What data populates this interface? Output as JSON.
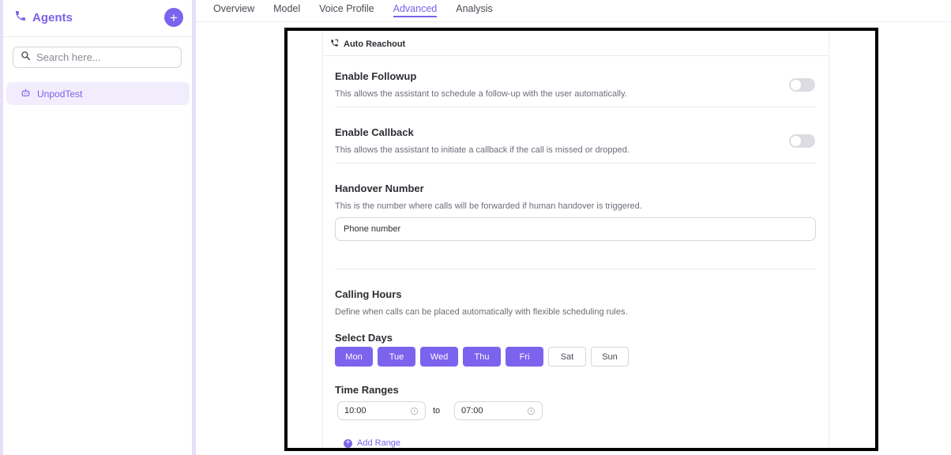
{
  "sidebar": {
    "title": "Agents",
    "add_label": "+",
    "search_placeholder": "Search here...",
    "items": [
      {
        "label": "UnpodTest"
      }
    ]
  },
  "tabs": [
    {
      "label": "Overview",
      "active": false
    },
    {
      "label": "Model",
      "active": false
    },
    {
      "label": "Voice Profile",
      "active": false
    },
    {
      "label": "Advanced",
      "active": true
    },
    {
      "label": "Analysis",
      "active": false
    }
  ],
  "card": {
    "title": "Auto Reachout",
    "followup": {
      "title": "Enable Followup",
      "desc": "This allows the assistant to schedule a follow-up with the user automatically.",
      "enabled": false
    },
    "callback": {
      "title": "Enable Callback",
      "desc": "This allows the assistant to initiate a callback if the call is missed or dropped.",
      "enabled": false
    },
    "handover": {
      "title": "Handover Number",
      "desc": "This is the number where calls will be forwarded if human handover is triggered.",
      "placeholder": "Phone number"
    },
    "calling_hours": {
      "title": "Calling Hours",
      "desc": "Define when calls can be placed automatically with flexible scheduling rules.",
      "days_label": "Select Days",
      "days": [
        {
          "label": "Mon",
          "selected": true
        },
        {
          "label": "Tue",
          "selected": true
        },
        {
          "label": "Wed",
          "selected": true
        },
        {
          "label": "Thu",
          "selected": true
        },
        {
          "label": "Fri",
          "selected": true
        },
        {
          "label": "Sat",
          "selected": false
        },
        {
          "label": "Sun",
          "selected": false
        }
      ],
      "time_ranges_label": "Time Ranges",
      "start": "10:00",
      "to_label": "to",
      "end": "07:00",
      "add_range": "Add Range"
    }
  },
  "colors": {
    "accent": "#7c63ee",
    "accent_text": "#7b61e8",
    "strip": "#e7def8"
  }
}
